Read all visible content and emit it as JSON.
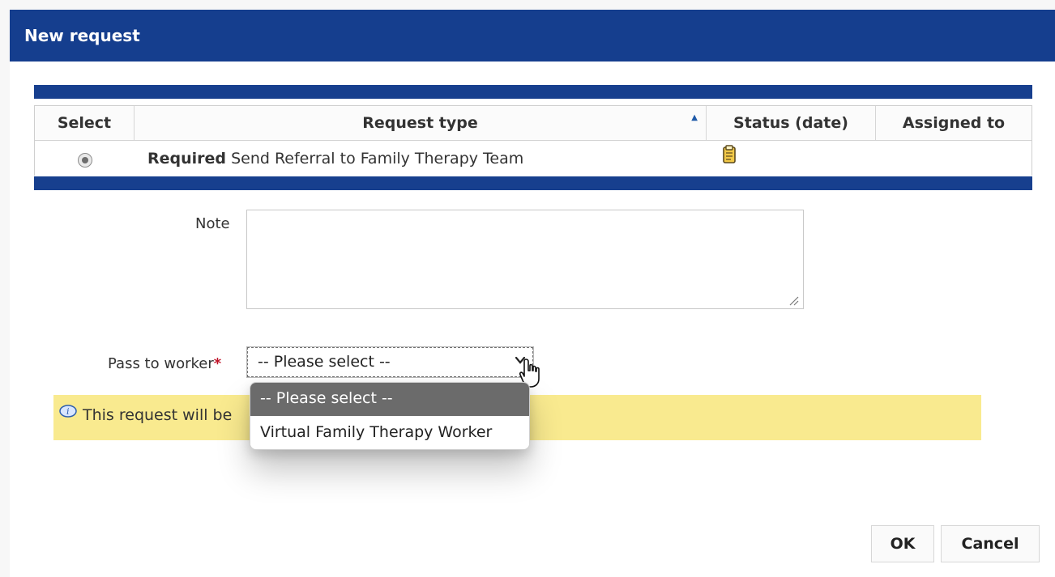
{
  "dialog": {
    "title": "New request"
  },
  "table": {
    "columns": [
      "Select",
      "Request type",
      "Status (date)",
      "Assigned to"
    ],
    "rows": [
      {
        "selected": true,
        "request_type_prefix": "Required",
        "request_type": "Send Referral to Family Therapy Team",
        "status_icon": "clipboard-icon",
        "assigned_to": ""
      }
    ]
  },
  "form": {
    "note_label": "Note",
    "note_value": "",
    "pass_label": "Pass to worker",
    "pass_required_mark": "*",
    "pass_value": "-- Please select --",
    "pass_options": [
      "-- Please select --",
      "Virtual Family Therapy Worker"
    ]
  },
  "info": {
    "icon": "info-icon",
    "text": "This request will be"
  },
  "buttons": {
    "ok": "OK",
    "cancel": "Cancel"
  },
  "colors": {
    "header": "#153e8e",
    "info_background": "#f9ea8f",
    "selected_option": "#6b6b6b",
    "required": "#c0162b"
  }
}
